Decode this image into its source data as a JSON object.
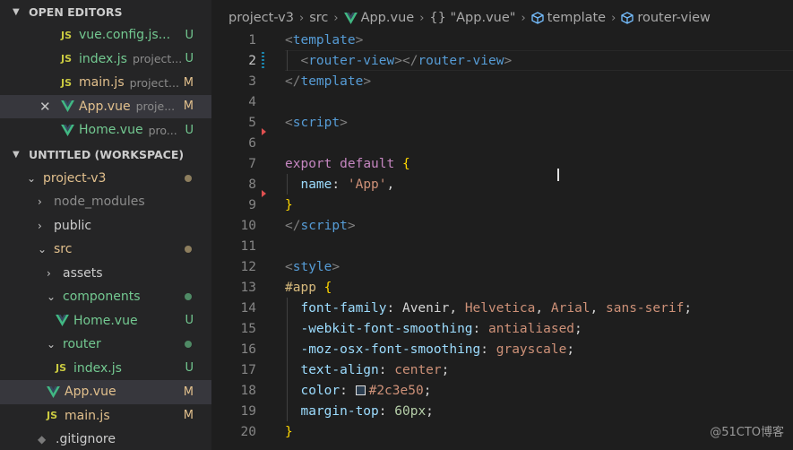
{
  "sidebar": {
    "open_editors": {
      "title": "OPEN EDITORS",
      "items": [
        {
          "name": "vue.config.js...",
          "path": "",
          "badge": "U",
          "type": "js"
        },
        {
          "name": "index.js",
          "path": "project...",
          "badge": "U",
          "type": "js"
        },
        {
          "name": "main.js",
          "path": "project...",
          "badge": "M",
          "type": "js"
        },
        {
          "name": "App.vue",
          "path": "proje...",
          "badge": "M",
          "type": "vue"
        },
        {
          "name": "Home.vue",
          "path": "pro...",
          "badge": "U",
          "type": "vue"
        }
      ]
    },
    "workspace": {
      "title": "UNTITLED (WORKSPACE)",
      "items": [
        {
          "name": "project-v3"
        },
        {
          "name": "node_modules"
        },
        {
          "name": "public"
        },
        {
          "name": "src"
        },
        {
          "name": "assets"
        },
        {
          "name": "components"
        },
        {
          "name": "Home.vue",
          "badge": "U"
        },
        {
          "name": "router"
        },
        {
          "name": "index.js",
          "badge": "U"
        },
        {
          "name": "App.vue",
          "badge": "M"
        },
        {
          "name": "main.js",
          "badge": "M"
        },
        {
          "name": ".gitignore"
        }
      ]
    }
  },
  "breadcrumb": {
    "project": "project-v3",
    "src": "src",
    "file": "App.vue",
    "obj": "{} \"App.vue\"",
    "template": "template",
    "router_view": "router-view"
  },
  "code": {
    "line_numbers": [
      "1",
      "2",
      "3",
      "4",
      "5",
      "6",
      "7",
      "8",
      "9",
      "10",
      "11",
      "12",
      "13",
      "14",
      "15",
      "16",
      "17",
      "18",
      "19",
      "20"
    ],
    "l1": {
      "open": "<",
      "tag": "template",
      "close": ">"
    },
    "l2": {
      "a": "<",
      "tag1": "router-view",
      "b": "></",
      "tag2": "router-view",
      "c": ">"
    },
    "l3": {
      "open": "</",
      "tag": "template",
      "close": ">"
    },
    "l5": {
      "open": "<",
      "tag": "script",
      "close": ">"
    },
    "l7": {
      "kw1": "export",
      "kw2": "default",
      "brace": "{"
    },
    "l8": {
      "prop": "name",
      "colon": ":",
      "str": "'App'",
      "comma": ","
    },
    "l9": {
      "brace": "}"
    },
    "l10": {
      "open": "</",
      "tag": "script",
      "close": ">"
    },
    "l12": {
      "open": "<",
      "tag": "style",
      "close": ">"
    },
    "l13": {
      "sel": "#app",
      "brace": "{"
    },
    "l14": {
      "prop": "font-family",
      "colon": ": ",
      "v1": "Avenir",
      "c1": ", ",
      "v2": "Helvetica",
      "c2": ", ",
      "v3": "Arial",
      "c3": ", ",
      "v4": "sans-serif",
      "semi": ";"
    },
    "l15": {
      "prop": "-webkit-font-smoothing",
      "colon": ": ",
      "val": "antialiased",
      "semi": ";"
    },
    "l16": {
      "prop": "-moz-osx-font-smoothing",
      "colon": ": ",
      "val": "grayscale",
      "semi": ";"
    },
    "l17": {
      "prop": "text-align",
      "colon": ": ",
      "val": "center",
      "semi": ";"
    },
    "l18": {
      "prop": "color",
      "colon": ": ",
      "val": "#2c3e50",
      "semi": ";"
    },
    "l19": {
      "prop": "margin-top",
      "colon": ": ",
      "val": "60px",
      "semi": ";"
    },
    "l20": {
      "brace": "}"
    }
  },
  "watermark": "@51CTO博客",
  "colors": {
    "accent": "#007acc",
    "untracked": "#73c991",
    "modified": "#e2c08d"
  }
}
